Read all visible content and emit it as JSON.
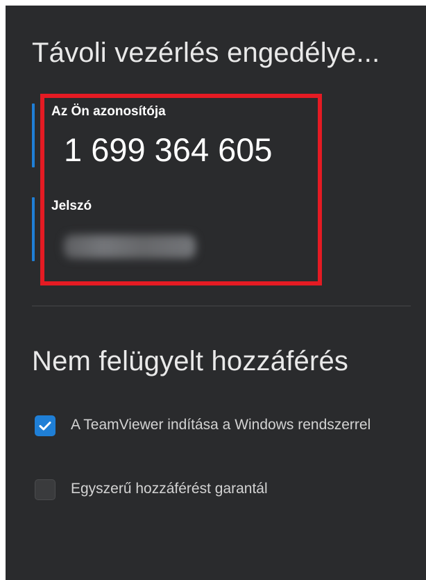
{
  "remote_control": {
    "title": "Távoli vezérlés engedélye...",
    "id_label": "Az Ön azonosítója",
    "id_value": "1 699 364 605",
    "password_label": "Jelszó"
  },
  "unattended_access": {
    "title": "Nem felügyelt hozzáférés",
    "options": [
      {
        "label": "A TeamViewer indítása a Windows rendszerrel",
        "checked": true
      },
      {
        "label": "Egyszerű hozzáférést garantál",
        "checked": false
      }
    ]
  },
  "colors": {
    "background": "#2a2b2d",
    "accent": "#1f7fd6",
    "highlight_border": "#e41b23"
  },
  "icons": {
    "check": "checkmark-icon"
  }
}
